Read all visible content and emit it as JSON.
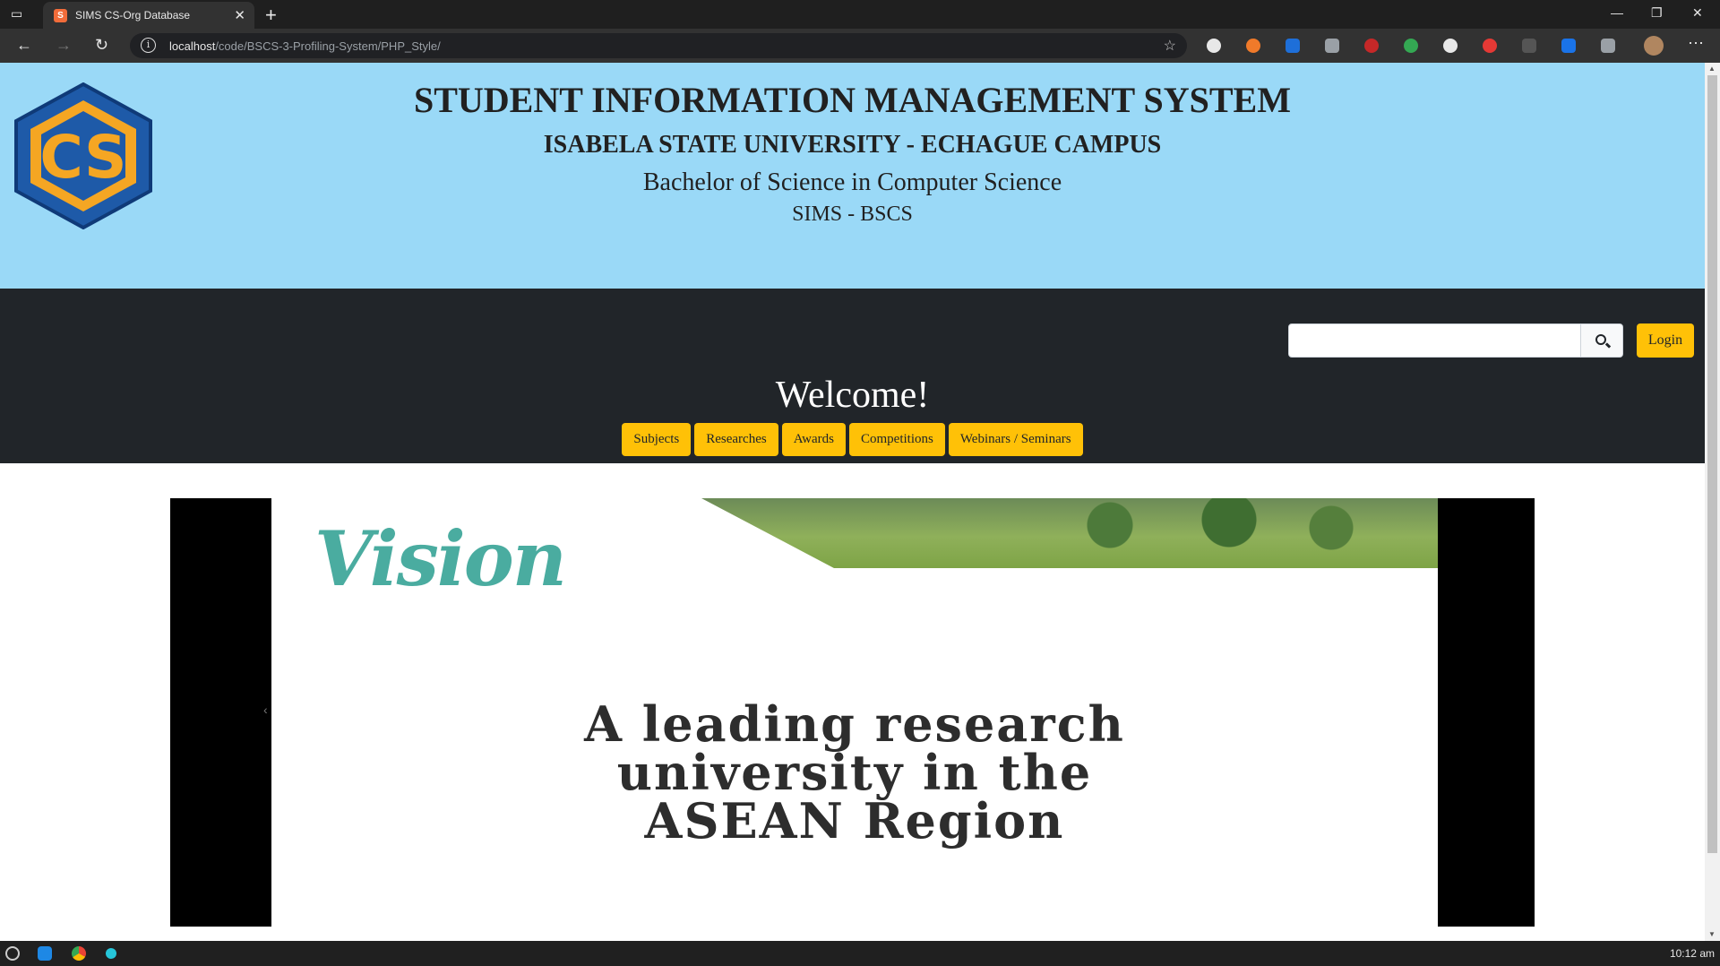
{
  "browser": {
    "tab_title": "SIMS CS-Org Database",
    "url_host": "localhost",
    "url_path": "/code/BSCS-3-Profiling-System/PHP_Style/"
  },
  "header": {
    "title": "STUDENT INFORMATION MANAGEMENT SYSTEM",
    "university": "ISABELA STATE UNIVERSITY - ECHAGUE CAMPUS",
    "course": "Bachelor of Science in Computer Science",
    "abbreviation": "SIMS - BSCS",
    "logo_text": "CS"
  },
  "nav": {
    "search_placeholder": "",
    "search_icon": "search-icon",
    "login_label": "Login",
    "welcome": "Welcome!",
    "menu": [
      "Subjects",
      "Researches",
      "Awards",
      "Competitions",
      "Webinars / Seminars"
    ]
  },
  "carousel": {
    "slide_heading": "Vision",
    "slide_text_line1": "A leading research",
    "slide_text_line2": "university in the",
    "slide_text_line3": "ASEAN Region"
  },
  "taskbar": {
    "clock": "10:12 am"
  },
  "colors": {
    "header_bg": "#9ad9f7",
    "nav_bg": "#212529",
    "accent": "#ffc107",
    "logo_blue": "#1e5aa8",
    "logo_orange": "#f5a623"
  }
}
